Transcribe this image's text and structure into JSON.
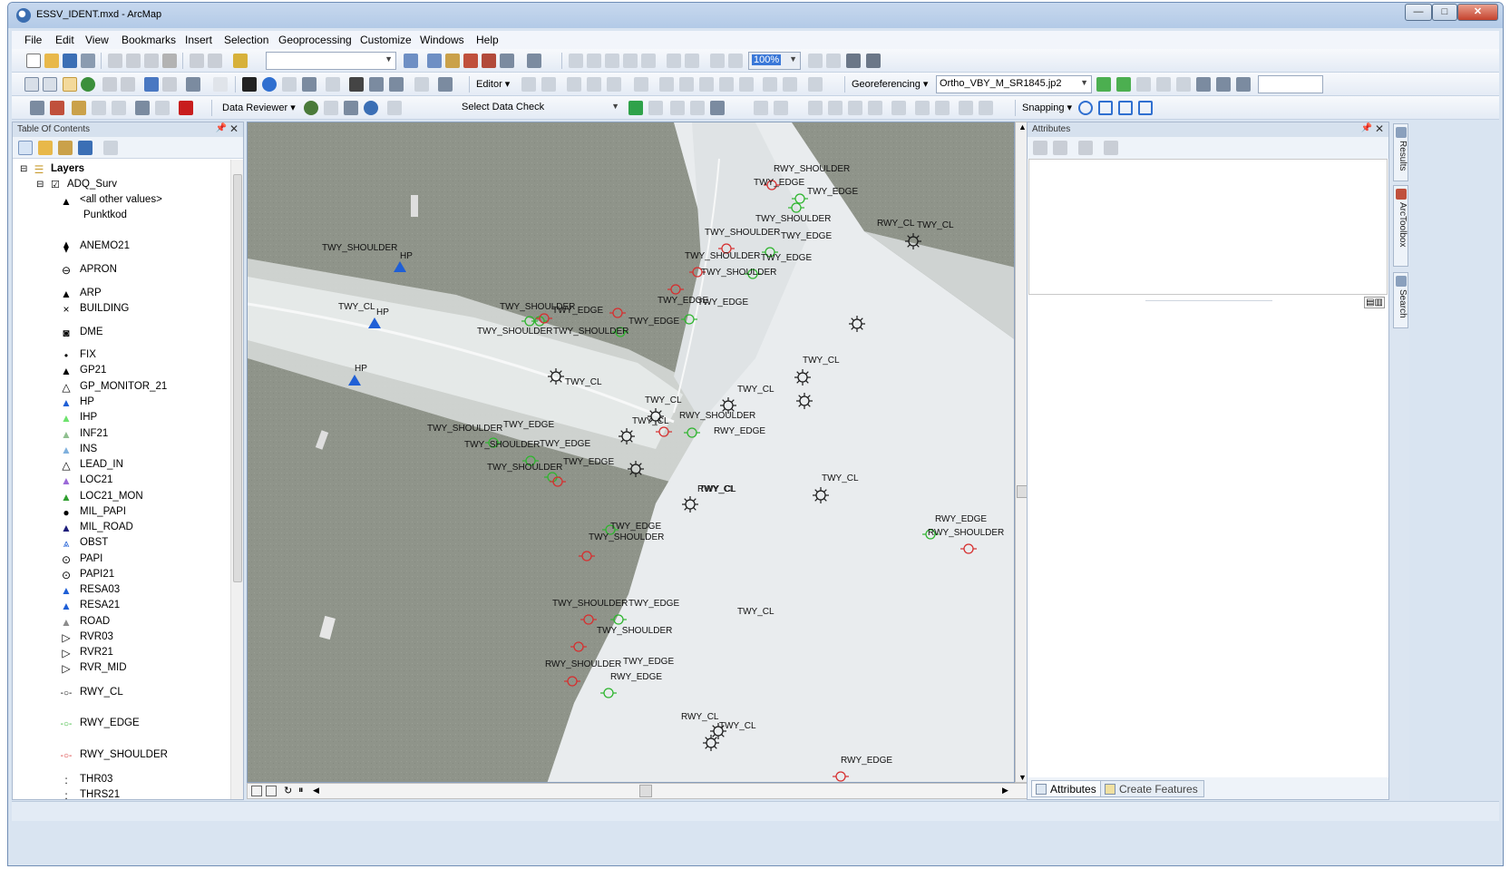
{
  "window": {
    "title": "ESSV_IDENT.mxd - ArcMap",
    "min_label": "—",
    "max_label": "□",
    "close_label": "✕"
  },
  "menu": [
    {
      "label": "File"
    },
    {
      "label": "Edit"
    },
    {
      "label": "View"
    },
    {
      "label": "Bookmarks"
    },
    {
      "label": "Insert"
    },
    {
      "label": "Selection"
    },
    {
      "label": "Geoprocessing"
    },
    {
      "label": "Customize"
    },
    {
      "label": "Windows"
    },
    {
      "label": "Help"
    }
  ],
  "toolbars": {
    "scale_value": "",
    "zoom_percent": "100%",
    "editor_label": "Editor ▾",
    "georeferencing_label": "Georeferencing ▾",
    "georef_layer": "Ortho_VBY_M_SR1845.jp2",
    "data_reviewer_label": "Data Reviewer ▾",
    "data_check": "Select Data Check",
    "snapping_label": "Snapping ▾",
    "georef_extra": ""
  },
  "toc": {
    "panel_title": "Table Of Contents",
    "root": "Layers",
    "layer": "ADQ_Surv",
    "all_other": "<all other values>",
    "field": "Punktkod",
    "legend": [
      {
        "label": "ANEMO21",
        "glyph": "⧫",
        "color": "#000000"
      },
      {
        "label": "APRON",
        "glyph": "⊖",
        "color": "#000000"
      },
      {
        "label": "ARP",
        "glyph": "▲",
        "color": "#000000"
      },
      {
        "label": "BUILDING",
        "glyph": "×",
        "color": "#000000"
      },
      {
        "label": "DME",
        "glyph": "◙",
        "color": "#000000"
      },
      {
        "label": "FIX",
        "glyph": "•",
        "color": "#000000"
      },
      {
        "label": "GP21",
        "glyph": "▲",
        "color": "#000000"
      },
      {
        "label": "GP_MONITOR_21",
        "glyph": "△",
        "color": "#000000"
      },
      {
        "label": "HP",
        "glyph": "▲",
        "color": "#1f5fd6"
      },
      {
        "label": "IHP",
        "glyph": "▲",
        "color": "#6de26d"
      },
      {
        "label": "INF21",
        "glyph": "▲",
        "color": "#8fbf8f"
      },
      {
        "label": "INS",
        "glyph": "▲",
        "color": "#7fb0dd"
      },
      {
        "label": "LEAD_IN",
        "glyph": "△",
        "color": "#000000"
      },
      {
        "label": "LOC21",
        "glyph": "▲",
        "color": "#9b6ad8"
      },
      {
        "label": "LOC21_MON",
        "glyph": "▲",
        "color": "#2f9e2f"
      },
      {
        "label": "MIL_PAPI",
        "glyph": "●",
        "color": "#000000"
      },
      {
        "label": "MIL_ROAD",
        "glyph": "▲",
        "color": "#1d1d7a"
      },
      {
        "label": "OBST",
        "glyph": "⩓",
        "color": "#1f5fd6"
      },
      {
        "label": "PAPI",
        "glyph": "⊙",
        "color": "#000000"
      },
      {
        "label": "PAPI21",
        "glyph": "⊙",
        "color": "#000000"
      },
      {
        "label": "RESA03",
        "glyph": "▲",
        "color": "#1f5fd6"
      },
      {
        "label": "RESA21",
        "glyph": "▲",
        "color": "#1f5fd6"
      },
      {
        "label": "ROAD",
        "glyph": "▲",
        "color": "#8c8c8c"
      },
      {
        "label": "RVR03",
        "glyph": "▷",
        "color": "#000000"
      },
      {
        "label": "RVR21",
        "glyph": "▷",
        "color": "#000000"
      },
      {
        "label": "RVR_MID",
        "glyph": "▷",
        "color": "#000000"
      },
      {
        "label": "RWY_CL",
        "glyph": "-○-",
        "color": "#000000"
      },
      {
        "label": "RWY_EDGE",
        "glyph": "-○-",
        "color": "#2fb52f"
      },
      {
        "label": "RWY_SHOULDER",
        "glyph": "-○-",
        "color": "#d62f2f"
      },
      {
        "label": "THR03",
        "glyph": ":",
        "color": "#000000"
      },
      {
        "label": "THRS21",
        "glyph": ":",
        "color": "#000000"
      }
    ]
  },
  "map": {
    "colors": {
      "cl": "#1a1a1a",
      "edge": "#2fb52f",
      "shoulder": "#d62f2f",
      "hp": "#1f5fd6",
      "grass": "#8f948a",
      "pavement": "#eef0f2"
    },
    "labels": [
      {
        "t": "RWY_SHOULDER"
      },
      {
        "t": "TWY_EDGE"
      },
      {
        "t": "TWY_EDGE"
      },
      {
        "t": "TWY_SHOULDER"
      },
      {
        "t": "RWY_CL"
      },
      {
        "t": "TWY_CL"
      },
      {
        "t": "TWY_SHOULDER"
      },
      {
        "t": "TWY_EDGE"
      },
      {
        "t": "TWY_SHOULDER"
      },
      {
        "t": "TWY_EDGE"
      },
      {
        "t": "TWY_SHOULDER"
      },
      {
        "t": "TWY_SHOULDER"
      },
      {
        "t": "HP"
      },
      {
        "t": "TWY_CL"
      },
      {
        "t": "HP"
      },
      {
        "t": "HP"
      },
      {
        "t": "TWY_SHOULDER"
      },
      {
        "t": "TWY_EDGE"
      },
      {
        "t": "TWY_EDGE"
      },
      {
        "t": "TWY_EDGE"
      },
      {
        "t": "TWY_EDGE"
      },
      {
        "t": "TWY_SHOULDER"
      },
      {
        "t": "TWY_SHOULDER"
      },
      {
        "t": "TWY_CL"
      },
      {
        "t": "TWY_CL"
      },
      {
        "t": "TWY_CL"
      },
      {
        "t": "TWY_CL"
      },
      {
        "t": "TWY_CL"
      },
      {
        "t": "TWY_CL"
      },
      {
        "t": "RWY_SHOULDER"
      },
      {
        "t": "RWY_EDGE"
      },
      {
        "t": "TWY_SHOULDER"
      },
      {
        "t": "TWY_EDGE"
      },
      {
        "t": "TWY_SHOULDER"
      },
      {
        "t": "TWY_EDGE"
      },
      {
        "t": "TWY_SHOULDER"
      },
      {
        "t": "TWY_EDGE"
      },
      {
        "t": "TWY_CL"
      },
      {
        "t": "RWY_CL"
      },
      {
        "t": "TWY_EDGE"
      },
      {
        "t": "TWY_SHOULDER"
      },
      {
        "t": "RWY_EDGE"
      },
      {
        "t": "RWY_SHOULDER"
      },
      {
        "t": "TWY_SHOULDER"
      },
      {
        "t": "TWY_EDGE"
      },
      {
        "t": "TWY_SHOULDER"
      },
      {
        "t": "TWY_CL"
      },
      {
        "t": "RWY_SHOULDER"
      },
      {
        "t": "TWY_EDGE"
      },
      {
        "t": "RWY_EDGE"
      },
      {
        "t": "RWY_CL"
      },
      {
        "t": "TWY_CL"
      },
      {
        "t": "RWY_EDGE"
      }
    ],
    "symbols": [
      {
        "k": "cl"
      },
      {
        "k": "cl"
      },
      {
        "k": "cl"
      },
      {
        "k": "cl"
      },
      {
        "k": "cl"
      },
      {
        "k": "cl"
      },
      {
        "k": "cl"
      },
      {
        "k": "cl"
      },
      {
        "k": "cl"
      },
      {
        "k": "cl"
      },
      {
        "k": "cl"
      },
      {
        "k": "cl"
      },
      {
        "k": "cl"
      },
      {
        "k": "edge"
      },
      {
        "k": "edge"
      },
      {
        "k": "edge"
      },
      {
        "k": "edge"
      },
      {
        "k": "edge"
      },
      {
        "k": "edge"
      },
      {
        "k": "edge"
      },
      {
        "k": "edge"
      },
      {
        "k": "edge"
      },
      {
        "k": "edge"
      },
      {
        "k": "edge"
      },
      {
        "k": "edge"
      },
      {
        "k": "edge"
      },
      {
        "k": "edge"
      },
      {
        "k": "edge"
      },
      {
        "k": "edge"
      },
      {
        "k": "shoulder"
      },
      {
        "k": "shoulder"
      },
      {
        "k": "shoulder"
      },
      {
        "k": "shoulder"
      },
      {
        "k": "shoulder"
      },
      {
        "k": "shoulder"
      },
      {
        "k": "shoulder"
      },
      {
        "k": "shoulder"
      },
      {
        "k": "shoulder"
      },
      {
        "k": "shoulder"
      },
      {
        "k": "shoulder"
      },
      {
        "k": "shoulder"
      },
      {
        "k": "shoulder"
      },
      {
        "k": "shoulder"
      },
      {
        "k": "hp"
      },
      {
        "k": "hp"
      },
      {
        "k": "hp"
      }
    ]
  },
  "attributes": {
    "panel_title": "Attributes",
    "tab_attributes": "Attributes",
    "tab_create": "Create Features"
  },
  "side_tabs": [
    {
      "label": "Results"
    },
    {
      "label": "ArcToolbox"
    },
    {
      "label": "Search"
    }
  ]
}
